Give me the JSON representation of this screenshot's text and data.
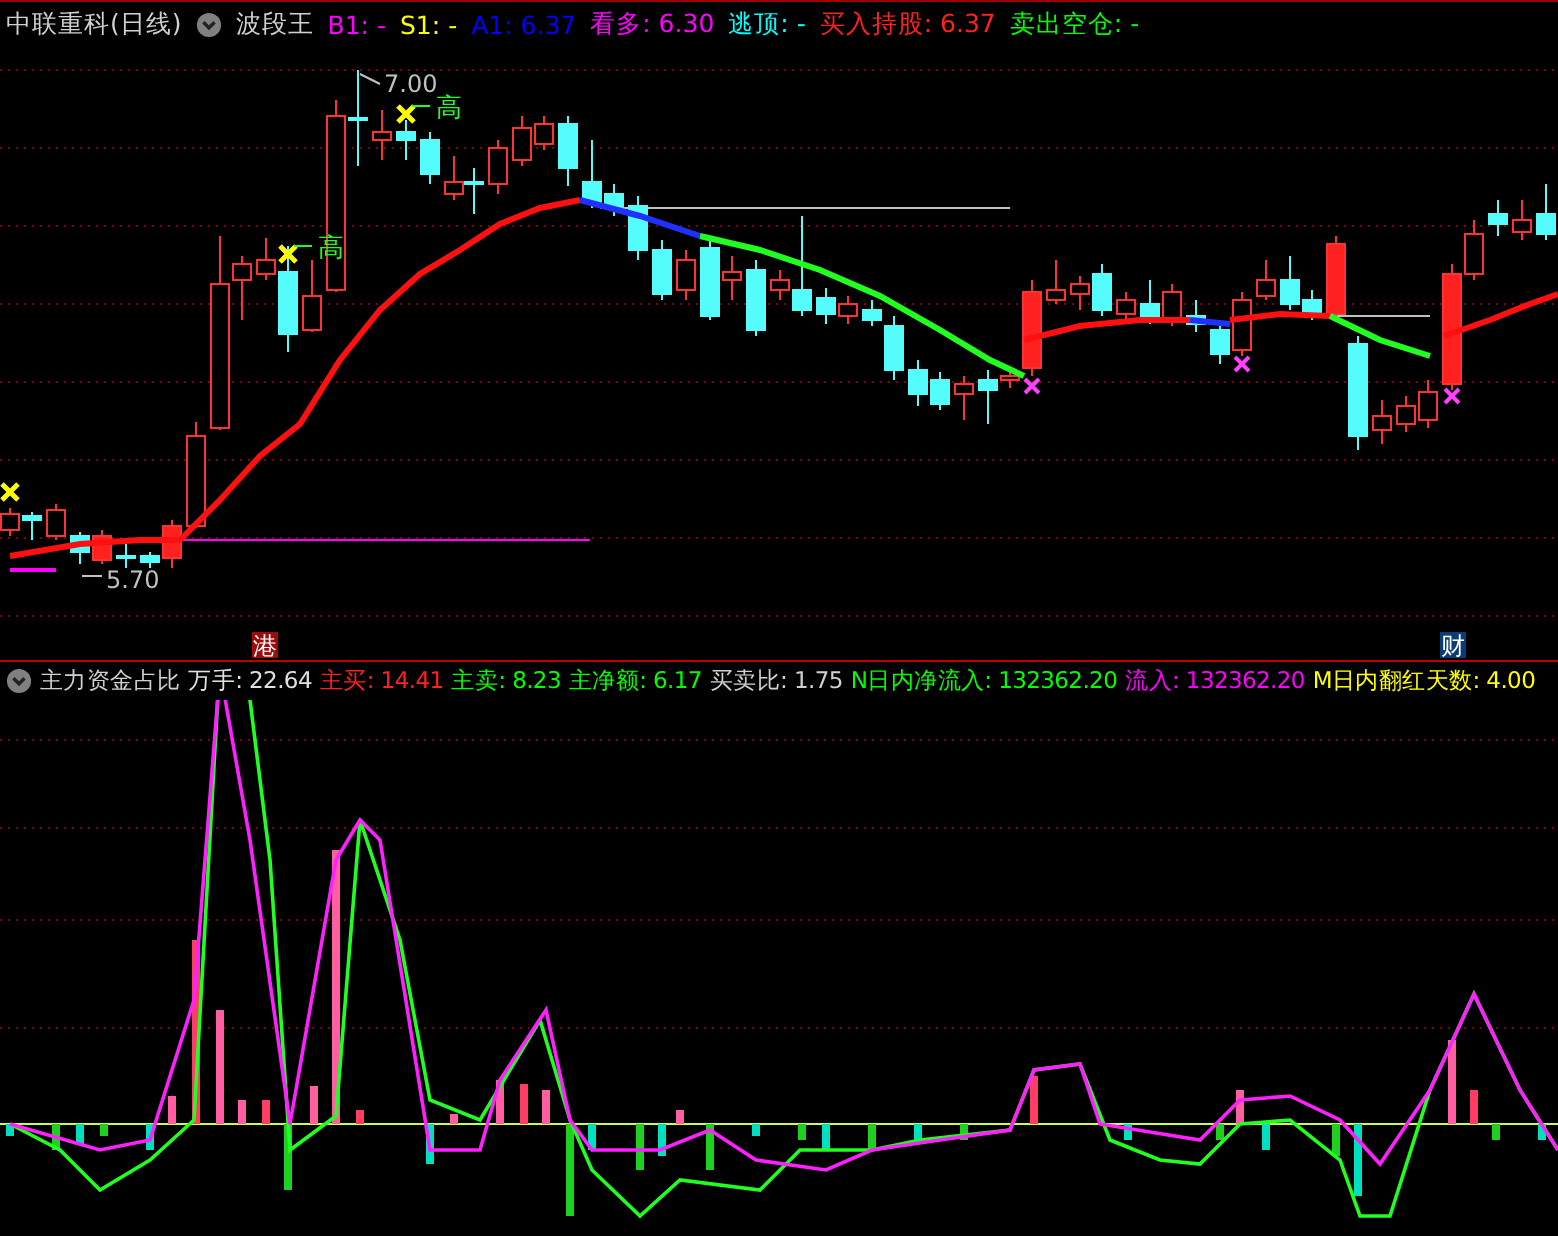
{
  "upper_header": {
    "stock": "中联重科(日线)",
    "indicator": "波段王",
    "values": [
      {
        "text": "B1: -",
        "color": "#ff00ff"
      },
      {
        "text": "S1: -",
        "color": "#ffff00"
      },
      {
        "text": "A1: 6.37",
        "color": "#0000ff"
      },
      {
        "text": "看多: 6.30",
        "color": "#ff00ff"
      },
      {
        "text": "逃顶: -",
        "color": "#00ffff"
      },
      {
        "text": "买入持股: 6.37",
        "color": "#ff2020"
      },
      {
        "text": "卖出空仓: -",
        "color": "#00ff00"
      }
    ]
  },
  "upper_chart": {
    "high_label": "7.00",
    "low_label": "5.70",
    "signal_labels": [
      "高",
      "高"
    ],
    "markers": [
      {
        "text": "港",
        "color": "#9c0c0c"
      },
      {
        "text": "财",
        "color": "#0c3c78"
      }
    ]
  },
  "lower_header": {
    "indicator": "主力资金占比",
    "values": [
      {
        "text": "万手: 22.64",
        "color": "#e0e0e0"
      },
      {
        "text": "主买: 14.41",
        "color": "#ff2020"
      },
      {
        "text": "主卖: 8.23",
        "color": "#00ff00"
      },
      {
        "text": "主净额: 6.17",
        "color": "#00ff00"
      },
      {
        "text": "买卖比: 1.75",
        "color": "#d0d0d0"
      },
      {
        "text": "N日内净流入: 132362.20",
        "color": "#00ff00"
      },
      {
        "text": "流入: 132362.20",
        "color": "#ff00ff"
      },
      {
        "text": "M日内翻红天数: 4.00",
        "color": "#ffff00"
      }
    ]
  }
}
